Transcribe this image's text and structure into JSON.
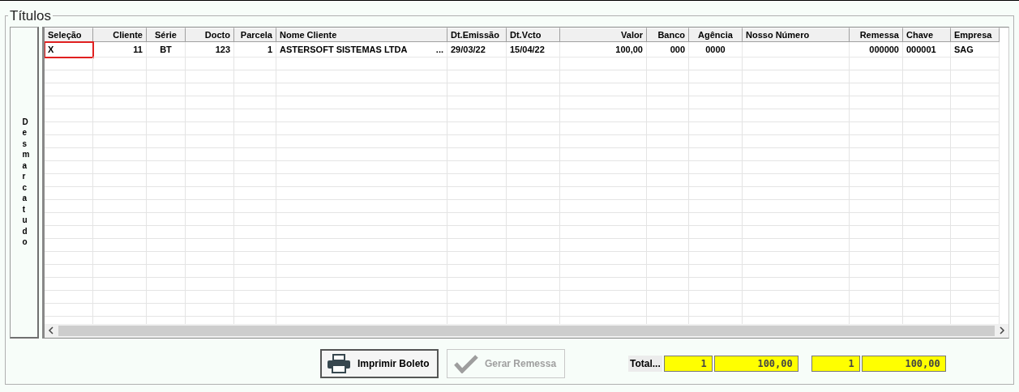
{
  "group": {
    "title": "Títulos"
  },
  "side_button": {
    "label": "Desmarca tudo"
  },
  "table": {
    "columns": [
      "Seleção",
      "Cliente",
      "Série",
      "Docto",
      "Parcela",
      "Nome Cliente",
      "Dt.Emissão",
      "Dt.Vcto",
      "Valor",
      "Banco",
      "Agência",
      "Nosso Número",
      "Remessa",
      "Chave",
      "Empresa"
    ],
    "rows": [
      {
        "selected": true,
        "cells": [
          "X",
          "11",
          "BT",
          "123",
          "1",
          "ASTERSOFT SISTEMAS LTDA",
          "29/03/22",
          "15/04/22",
          "100,00",
          "000",
          "0000",
          "",
          "000000",
          "000001",
          "SAG"
        ],
        "name_more": "..."
      }
    ]
  },
  "buttons": [
    {
      "label": "Imprimir Boleto",
      "disabled": false,
      "kind": "print"
    },
    {
      "label": "Gerar Remessa",
      "disabled": true,
      "kind": "check"
    }
  ],
  "totals": {
    "label": "Total...",
    "fields": [
      "1",
      "100,00",
      "1",
      "100,00"
    ]
  }
}
